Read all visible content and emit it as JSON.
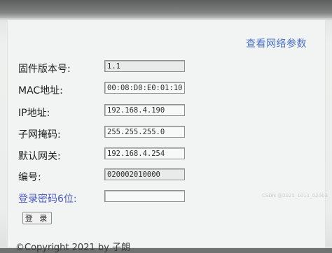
{
  "header": {
    "view_network_params": "查看网络参数"
  },
  "fields": [
    {
      "label": "固件版本号:",
      "value": "1.1"
    },
    {
      "label": "MAC地址:",
      "value": "00:08:D0:E0:01:10"
    },
    {
      "label": "IP地址:",
      "value": "192.168.4.190"
    },
    {
      "label": "子网掩码:",
      "value": "255.255.255.0"
    },
    {
      "label": "默认网关:",
      "value": "192.168.4.254"
    },
    {
      "label": "编号:",
      "value": "020002010000"
    },
    {
      "label": "登录密码6位:",
      "value": ""
    }
  ],
  "login_button": "登 录",
  "footer": "©Copyright 2021 by 子朗",
  "watermark": "CSDN @2021_1011_02003"
}
